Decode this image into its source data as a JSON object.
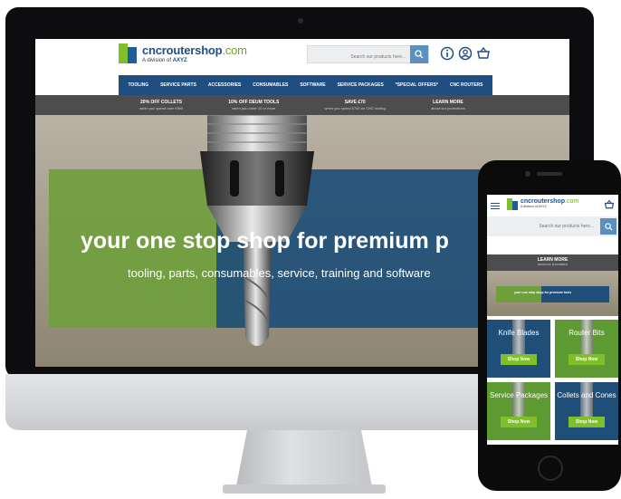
{
  "desktop": {
    "logo": {
      "name": "cncroutershop",
      "tld": ".com",
      "tagline_prefix": "A division of",
      "tagline_brand": "AXYZ"
    },
    "search": {
      "placeholder": "Search our products here..."
    },
    "icons": {
      "search": "search-icon",
      "info": "info-icon",
      "account": "user-icon",
      "cart": "basket-icon"
    },
    "nav": [
      "TOOLING",
      "SERVICE PARTS",
      "ACCESSORIES",
      "CONSUMABLES",
      "SOFTWARE",
      "SERVICE PACKAGES",
      "*SPECIAL OFFERS*",
      "CNC ROUTERS"
    ],
    "promos": [
      {
        "title": "20% OFF COLLETS",
        "sub": "when you spend over £900"
      },
      {
        "title": "10% OFF DEUM TOOLS",
        "sub": "when you order 10 or more"
      },
      {
        "title": "SAVE £70",
        "sub": "when you spend £700 on CNC tooling"
      },
      {
        "title": "LEARN MORE",
        "sub": "about our promotions"
      }
    ],
    "hero": {
      "title": "your one stop shop for premium p",
      "subtitle": "tooling, parts, consumables, service, training and software"
    }
  },
  "mobile": {
    "logo": {
      "name": "cncroutershop",
      "tld": ".com",
      "tagline": "A division of AXYZ"
    },
    "search": {
      "placeholder": "Search our products here..."
    },
    "promo": {
      "title": "LEARN MORE",
      "sub": "about our promotions"
    },
    "hero_text": "your one stop shop for premium tools",
    "tiles": [
      {
        "label": "Knife Blades",
        "button": "Shop Now",
        "color": "#1f4f78"
      },
      {
        "label": "Router Bits",
        "button": "Shop Now",
        "color": "#5e9a32"
      },
      {
        "label": "Service Packages",
        "button": "Shop Now",
        "color": "#5e9a32"
      },
      {
        "label": "Collets and Cones",
        "button": "Shop Now",
        "color": "#1f4f78"
      }
    ]
  },
  "colors": {
    "brand_blue": "#1e4f86",
    "brand_green": "#7fbf2a",
    "promo_bar": "#4d4d4d"
  }
}
